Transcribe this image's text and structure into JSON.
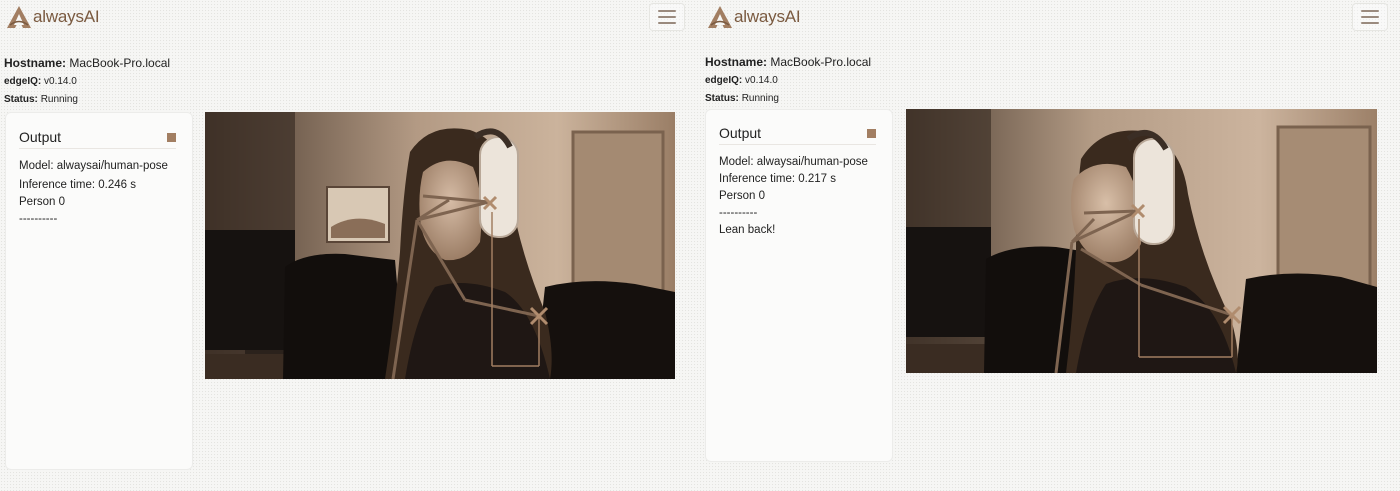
{
  "brand": {
    "name": "alwaysAI"
  },
  "colors": {
    "accent": "#a27e62",
    "logo": "#7a5a40",
    "pose": "#9a7a5e"
  },
  "icons": {
    "menu": "hamburger-menu-icon",
    "stop": "stop-square-icon",
    "logo": "alwaysai-logo-icon"
  },
  "panels": [
    {
      "info": {
        "hostname_label": "Hostname:",
        "hostname": "MacBook-Pro.local",
        "edgeiq_label": "edgeIQ:",
        "edgeiq": "v0.14.0",
        "status_label": "Status:",
        "status": "Running"
      },
      "output": {
        "title": "Output",
        "lines": [
          "Model: alwaysai/human-pose",
          "Inference time: 0.246 s",
          "Person 0",
          "----------",
          ""
        ]
      }
    },
    {
      "info": {
        "hostname_label": "Hostname:",
        "hostname": "MacBook-Pro.local",
        "edgeiq_label": "edgeIQ:",
        "edgeiq": "v0.14.0",
        "status_label": "Status:",
        "status": "Running"
      },
      "output": {
        "title": "Output",
        "lines": [
          "Model: alwaysai/human-pose",
          "Inference time: 0.217 s",
          "Person 0",
          "----------",
          "Lean back!"
        ]
      }
    }
  ]
}
